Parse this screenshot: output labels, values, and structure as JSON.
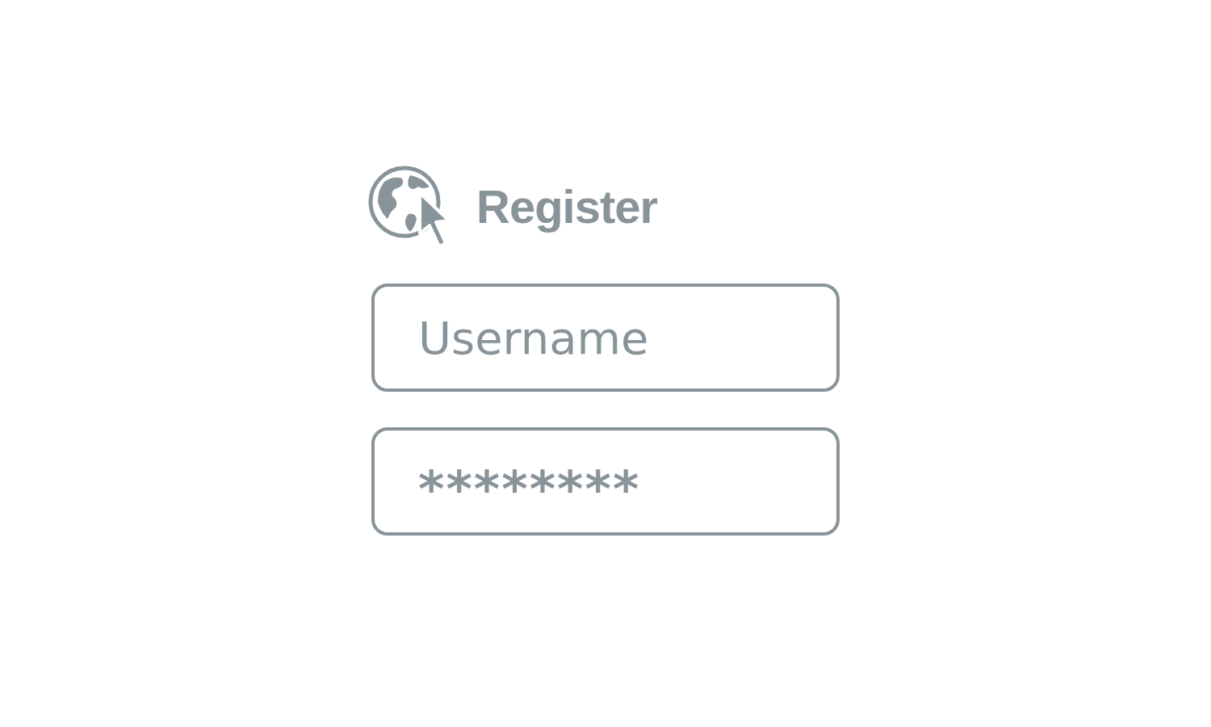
{
  "header": {
    "title": "Register"
  },
  "fields": [
    {
      "placeholder": "Username"
    },
    {
      "value": "********"
    }
  ]
}
